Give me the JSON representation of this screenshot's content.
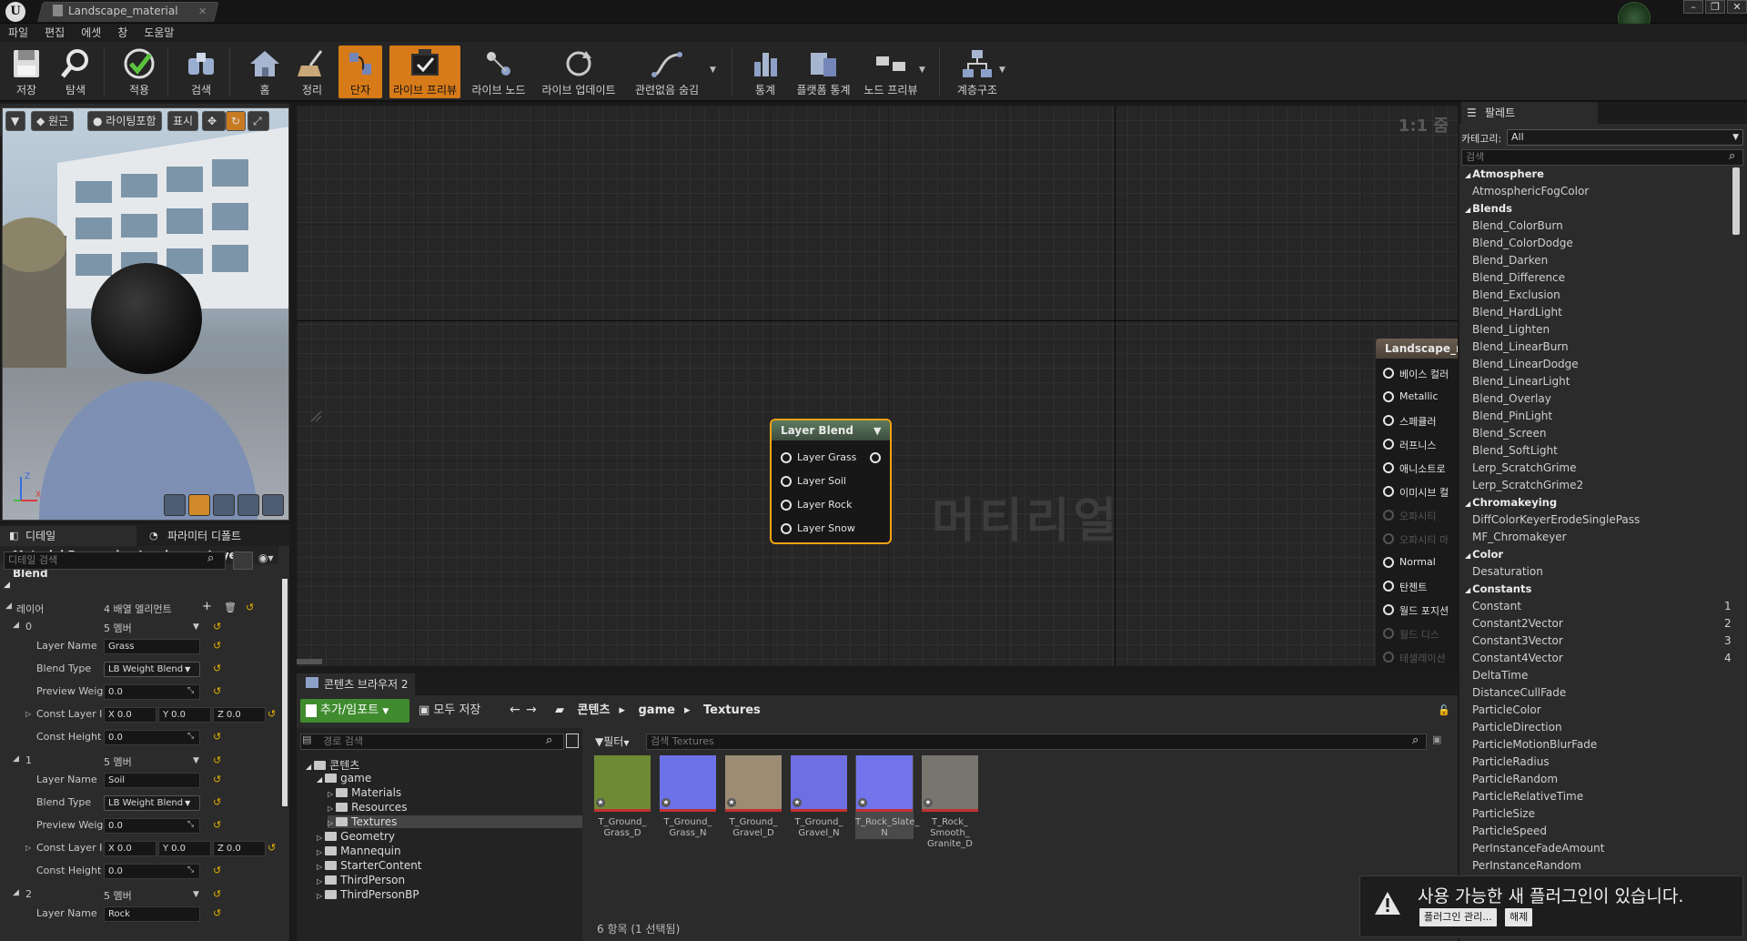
{
  "window": {
    "tab_title": "Landscape_material"
  },
  "menu": [
    "파일",
    "편집",
    "에셋",
    "창",
    "도움말"
  ],
  "toolbar": [
    {
      "label": "저장",
      "icon": "save-icon"
    },
    {
      "label": "탐색",
      "icon": "search-icon"
    },
    {
      "label": "적용",
      "icon": "check-icon"
    },
    {
      "label": "검색",
      "icon": "binoculars-icon"
    },
    {
      "label": "홈",
      "icon": "home-icon"
    },
    {
      "label": "정리",
      "icon": "broom-icon"
    },
    {
      "label": "단자",
      "icon": "connector-icon",
      "active": true
    },
    {
      "label": "라이브 프리뷰",
      "icon": "live-preview-icon",
      "active": true
    },
    {
      "label": "라이브 노드",
      "icon": "live-nodes-icon"
    },
    {
      "label": "라이브 업데이트",
      "icon": "live-update-icon"
    },
    {
      "label": "관련없음 숨김",
      "icon": "hide-unrelated-icon"
    },
    {
      "label": "통계",
      "icon": "stats-icon"
    },
    {
      "label": "플랫폼 통계",
      "icon": "platform-stats-icon"
    },
    {
      "label": "노드 프리뷰",
      "icon": "node-preview-icon"
    },
    {
      "label": "계층구조",
      "icon": "hierarchy-icon"
    }
  ],
  "viewport_bar": {
    "perspective": "원근",
    "lighting": "라이팅포함",
    "show": "표시"
  },
  "details": {
    "tabs": [
      "디테일",
      "파라미터 디폴트"
    ],
    "search_placeholder": "디테일 검색",
    "header": "Material Expression Landscape Layer Blend",
    "layers_label": "레이어",
    "layers_value": "4 배열 엘리먼트",
    "entries": [
      {
        "index": "0",
        "members": "5 멤버",
        "layer_name": "Grass",
        "blend_type": "LB Weight Blend",
        "preview_weight": "0.0",
        "const_layer": [
          "0.0",
          "0.0",
          "0.0"
        ],
        "const_height": "0.0"
      },
      {
        "index": "1",
        "members": "5 멤버",
        "layer_name": "Soil",
        "blend_type": "LB Weight Blend",
        "preview_weight": "0.0",
        "const_layer": [
          "0.0",
          "0.0",
          "0.0"
        ],
        "const_height": "0.0"
      },
      {
        "index": "2",
        "members": "5 멤버",
        "layer_name": "Rock"
      }
    ],
    "labels": {
      "layer_name": "Layer Name",
      "blend_type": "Blend Type",
      "preview_weight": "Preview Weig",
      "const_layer": "Const Layer I",
      "const_height": "Const Height",
      "x": "X",
      "y": "Y",
      "z": "Z"
    }
  },
  "graph": {
    "zoom": "1:1 줌",
    "watermark": "머티리얼",
    "layer_blend_node": {
      "title": "Layer Blend",
      "pins": [
        "Layer Grass",
        "Layer Soil",
        "Layer Rock",
        "Layer Snow"
      ]
    },
    "result_node": {
      "title": "Landscape_m",
      "pins": [
        {
          "label": "베이스 컬러",
          "dim": false
        },
        {
          "label": "Metallic",
          "dim": false
        },
        {
          "label": "스페큘러",
          "dim": false
        },
        {
          "label": "러프니스",
          "dim": false
        },
        {
          "label": "애니소트로",
          "dim": false
        },
        {
          "label": "이미시브 컬",
          "dim": false
        },
        {
          "label": "오파시티",
          "dim": true
        },
        {
          "label": "오파시티 마",
          "dim": true
        },
        {
          "label": "Normal",
          "dim": false
        },
        {
          "label": "탄젠트",
          "dim": false
        },
        {
          "label": "월드 포지션",
          "dim": false
        },
        {
          "label": "월드 디스",
          "dim": true
        },
        {
          "label": "테셀레이션",
          "dim": true
        }
      ]
    }
  },
  "content_browser": {
    "tab": "콘텐츠 브라우저 2",
    "add_import": "추가/임포트",
    "save_all": "모두 저장",
    "path": [
      "콘텐츠",
      "game",
      "Textures"
    ],
    "path_search_placeholder": "경로 검색",
    "filter": "필터",
    "asset_search_placeholder": "검색 Textures",
    "tree": [
      {
        "label": "콘텐츠",
        "level": 0
      },
      {
        "label": "game",
        "level": 1
      },
      {
        "label": "Materials",
        "level": 2
      },
      {
        "label": "Resources",
        "level": 2
      },
      {
        "label": "Textures",
        "level": 2,
        "selected": true
      },
      {
        "label": "Geometry",
        "level": 1
      },
      {
        "label": "Mannequin",
        "level": 1
      },
      {
        "label": "StarterContent",
        "level": 1
      },
      {
        "label": "ThirdPerson",
        "level": 1
      },
      {
        "label": "ThirdPersonBP",
        "level": 1
      }
    ],
    "assets": [
      {
        "line1": "T_Ground_",
        "line2": "Grass_D",
        "line3": "",
        "color": "#6f8a35"
      },
      {
        "line1": "T_Ground_",
        "line2": "Grass_N",
        "line3": "",
        "color": "#6e72e8"
      },
      {
        "line1": "T_Ground_",
        "line2": "Gravel_D",
        "line3": "",
        "color": "#9c8c74"
      },
      {
        "line1": "T_Ground_",
        "line2": "Gravel_N",
        "line3": "",
        "color": "#6d6fe2"
      },
      {
        "line1": "T_Rock_Slate_",
        "line2": "N",
        "line3": "",
        "color": "#7174ea",
        "selected": true
      },
      {
        "line1": "T_Rock_",
        "line2": "Smooth_",
        "line3": "Granite_D",
        "color": "#77756d"
      }
    ],
    "count": "6 항목 (1 선택됨)"
  },
  "palette": {
    "tab": "팔레트",
    "category_label": "카테고리:",
    "category_value": "All",
    "search_placeholder": "검색",
    "groups": [
      {
        "name": "Atmosphere",
        "items": [
          "AtmosphericFogColor"
        ]
      },
      {
        "name": "Blends",
        "items": [
          "Blend_ColorBurn",
          "Blend_ColorDodge",
          "Blend_Darken",
          "Blend_Difference",
          "Blend_Exclusion",
          "Blend_HardLight",
          "Blend_Lighten",
          "Blend_LinearBurn",
          "Blend_LinearDodge",
          "Blend_LinearLight",
          "Blend_Overlay",
          "Blend_PinLight",
          "Blend_Screen",
          "Blend_SoftLight",
          "Lerp_ScratchGrime",
          "Lerp_ScratchGrime2"
        ]
      },
      {
        "name": "Chromakeying",
        "items": [
          "DiffColorKeyerErodeSinglePass",
          "MF_Chromakeyer"
        ]
      },
      {
        "name": "Color",
        "items": [
          "Desaturation"
        ]
      },
      {
        "name": "Constants",
        "items": [
          "Constant",
          "Constant2Vector",
          "Constant3Vector",
          "Constant4Vector",
          "DeltaTime",
          "DistanceCullFade",
          "ParticleColor",
          "ParticleDirection",
          "ParticleMotionBlurFade",
          "ParticleRadius",
          "ParticleRandom",
          "ParticleRelativeTime",
          "ParticleSize",
          "ParticleSpeed",
          "PerInstanceFadeAmount",
          "PerInstanceRandom"
        ]
      }
    ],
    "shortcuts": {
      "Constant": "1",
      "Constant2Vector": "2",
      "Constant3Vector": "3",
      "Constant4Vector": "4"
    }
  },
  "notification": {
    "message": "사용 가능한 새 플러그인이 있습니다.",
    "manage": "플러그인 관리...",
    "dismiss": "해제"
  }
}
